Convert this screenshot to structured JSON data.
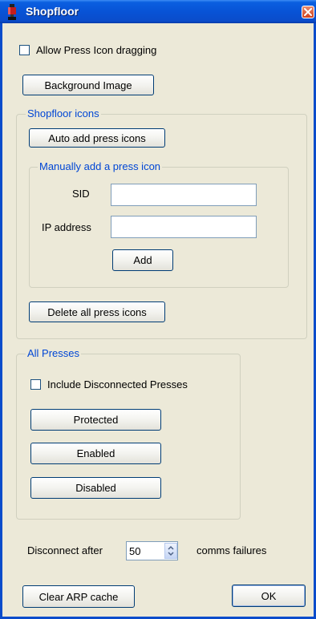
{
  "window": {
    "title": "Shopfloor",
    "icons": {
      "app": "press-icon",
      "close": "close-icon"
    }
  },
  "top": {
    "allow_dragging_label": "Allow Press Icon dragging",
    "allow_dragging_checked": false,
    "background_image_label": "Background Image"
  },
  "shopfloor_icons": {
    "legend": "Shopfloor icons",
    "auto_add_label": "Auto add press icons",
    "manual": {
      "legend": "Manually add a press icon",
      "sid_label": "SID",
      "sid_value": "",
      "ip_label": "IP address",
      "ip_value": "",
      "add_label": "Add"
    },
    "delete_all_label": "Delete all press icons"
  },
  "all_presses": {
    "legend": "All Presses",
    "include_disconnected_label": "Include Disconnected Presses",
    "include_disconnected_checked": false,
    "protected_label": "Protected",
    "enabled_label": "Enabled",
    "disabled_label": "Disabled"
  },
  "footer": {
    "disconnect_prefix": "Disconnect after",
    "disconnect_value": "50",
    "disconnect_suffix": "comms failures",
    "clear_arp_label": "Clear ARP cache",
    "ok_label": "OK"
  },
  "colors": {
    "title_bar": "#0a4ccb",
    "dialog_bg": "#ece9d8",
    "group_legend": "#0046d5"
  }
}
